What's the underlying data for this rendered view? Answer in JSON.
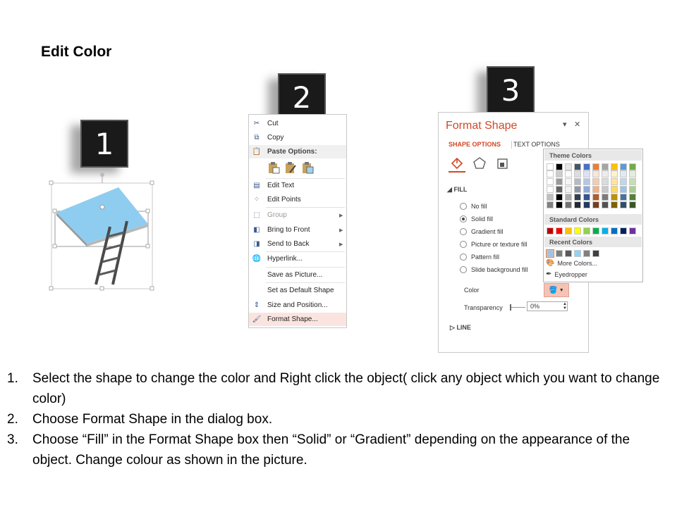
{
  "title": "Edit Color",
  "badges": [
    "1",
    "2",
    "3"
  ],
  "context_menu": {
    "items": [
      {
        "icon": "scissors-icon",
        "label": "Cut"
      },
      {
        "icon": "copy-icon",
        "label": "Copy"
      },
      {
        "icon": "paste-icon",
        "label": "Paste Options:"
      },
      {
        "icon": "edit-text-icon",
        "label": "Edit Text"
      },
      {
        "icon": "edit-points-icon",
        "label": "Edit Points"
      },
      {
        "icon": "group-icon",
        "label": "Group"
      },
      {
        "icon": "bring-to-front-icon",
        "label": "Bring to Front"
      },
      {
        "icon": "send-to-back-icon",
        "label": "Send to Back"
      },
      {
        "icon": "hyperlink-icon",
        "label": "Hyperlink..."
      },
      {
        "icon": "",
        "label": "Save as Picture..."
      },
      {
        "icon": "",
        "label": "Set as Default Shape"
      },
      {
        "icon": "size-position-icon",
        "label": "Size and Position..."
      },
      {
        "icon": "format-shape-icon",
        "label": "Format Shape..."
      }
    ]
  },
  "format_pane": {
    "title": "Format Shape",
    "tabs": [
      "SHAPE OPTIONS",
      "TEXT OPTIONS"
    ],
    "fill_header": "FILL",
    "fill_options": [
      "No fill",
      "Solid fill",
      "Gradient fill",
      "Picture or texture fill",
      "Pattern fill",
      "Slide background fill"
    ],
    "selected_fill": "Solid fill",
    "color_label": "Color",
    "transparency_label": "Transparency",
    "transparency_value": "0%",
    "line_header": "LINE"
  },
  "color_popup": {
    "theme_header": "Theme Colors",
    "standard_header": "Standard Colors",
    "recent_header": "Recent Colors",
    "more_colors": "More Colors...",
    "eyedropper": "Eyedropper",
    "theme_top": [
      "#ffffff",
      "#000000",
      "#e7e6e6",
      "#44546a",
      "#4472c4",
      "#ed7d31",
      "#a5a5a5",
      "#ffc000",
      "#5b9bd5",
      "#70ad47"
    ],
    "standard": [
      "#c00000",
      "#ff0000",
      "#ffc000",
      "#ffff00",
      "#92d050",
      "#00b050",
      "#00b0f0",
      "#0070c0",
      "#002060",
      "#7030a0"
    ],
    "recent": [
      "#9dc3e6",
      "#7f7f7f",
      "#595959",
      "#8fd4f2",
      "#808080",
      "#404040"
    ]
  },
  "colors": {
    "accent": "#d24726",
    "shape_fill": "#8fcdf0",
    "badge_bg": "#1a1a1a"
  },
  "instructions": [
    {
      "num": "1.",
      "text": "Select the shape to change the color and Right click the object( click any object which you want to change color)"
    },
    {
      "num": "2.",
      "text": "Choose Format Shape in the dialog box."
    },
    {
      "num": "3.",
      "text": "Choose “Fill” in the Format Shape box then “Solid” or “Gradient” depending on the appearance of the object. Change colour as shown in the picture."
    }
  ]
}
